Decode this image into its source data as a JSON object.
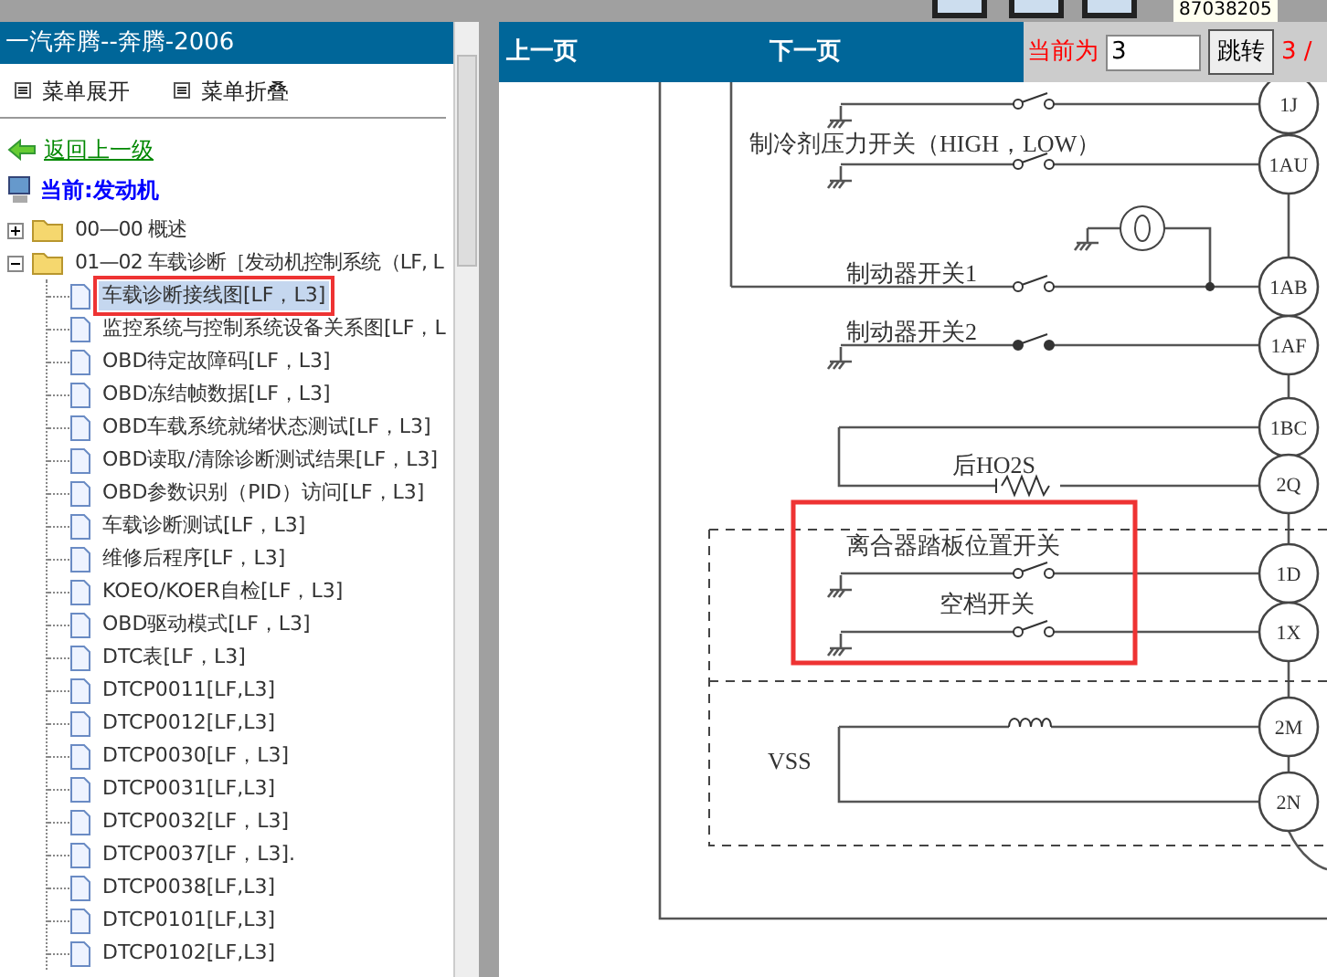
{
  "top_strip": {
    "phone": "87038205"
  },
  "sidebar": {
    "title": "一汽奔腾--奔腾-2006",
    "menu_buttons": [
      "菜单展开",
      "菜单折叠"
    ],
    "back_link": "返回上一级",
    "current": "当前:发动机",
    "tree": [
      {
        "label": "00—00 概述",
        "expanded": false
      },
      {
        "label": "01—02 车载诊断［发动机控制系统（LF, L",
        "expanded": true,
        "children": [
          {
            "label": "车载诊断接线图[LF，L3]",
            "selected": true
          },
          {
            "label": "监控系统与控制系统设备关系图[LF，L",
            "selected": false
          },
          {
            "label": "OBD待定故障码[LF，L3]",
            "selected": false
          },
          {
            "label": "OBD冻结帧数据[LF，L3]",
            "selected": false
          },
          {
            "label": "OBD车载系统就绪状态测试[LF，L3]",
            "selected": false
          },
          {
            "label": "OBD读取/清除诊断测试结果[LF，L3]",
            "selected": false
          },
          {
            "label": "OBD参数识别（PID）访问[LF，L3]",
            "selected": false
          },
          {
            "label": "车载诊断测试[LF，L3]",
            "selected": false
          },
          {
            "label": "维修后程序[LF，L3]",
            "selected": false
          },
          {
            "label": "KOEO/KOER自检[LF，L3]",
            "selected": false
          },
          {
            "label": "OBD驱动模式[LF，L3]",
            "selected": false
          },
          {
            "label": "DTC表[LF，L3]",
            "selected": false
          },
          {
            "label": "DTCP0011[LF,L3]",
            "selected": false
          },
          {
            "label": "DTCP0012[LF,L3]",
            "selected": false
          },
          {
            "label": "DTCP0030[LF，L3]",
            "selected": false
          },
          {
            "label": "DTCP0031[LF,L3]",
            "selected": false
          },
          {
            "label": "DTCP0032[LF，L3]",
            "selected": false
          },
          {
            "label": "DTCP0037[LF，L3].",
            "selected": false
          },
          {
            "label": "DTCP0038[LF,L3]",
            "selected": false
          },
          {
            "label": "DTCP0101[LF,L3]",
            "selected": false
          },
          {
            "label": "DTCP0102[LF,L3]",
            "selected": false
          }
        ]
      }
    ]
  },
  "viewer": {
    "prev": "上一页",
    "next": "下一页",
    "current_label": "当前为",
    "page_input": "3",
    "jump_button": "跳转",
    "page_count": "3 /"
  },
  "diagram": {
    "connectors": [
      "1J",
      "1AU",
      "1AB",
      "1AF",
      "1BC",
      "2Q",
      "1D",
      "1X",
      "2M",
      "2N"
    ],
    "labels": [
      "制冷剂压力开关（HIGH，LOW）",
      "制动器开关1",
      "制动器开关2",
      "后HO2S",
      "离合器踏板位置开关",
      "空档开关",
      "VSS"
    ]
  }
}
